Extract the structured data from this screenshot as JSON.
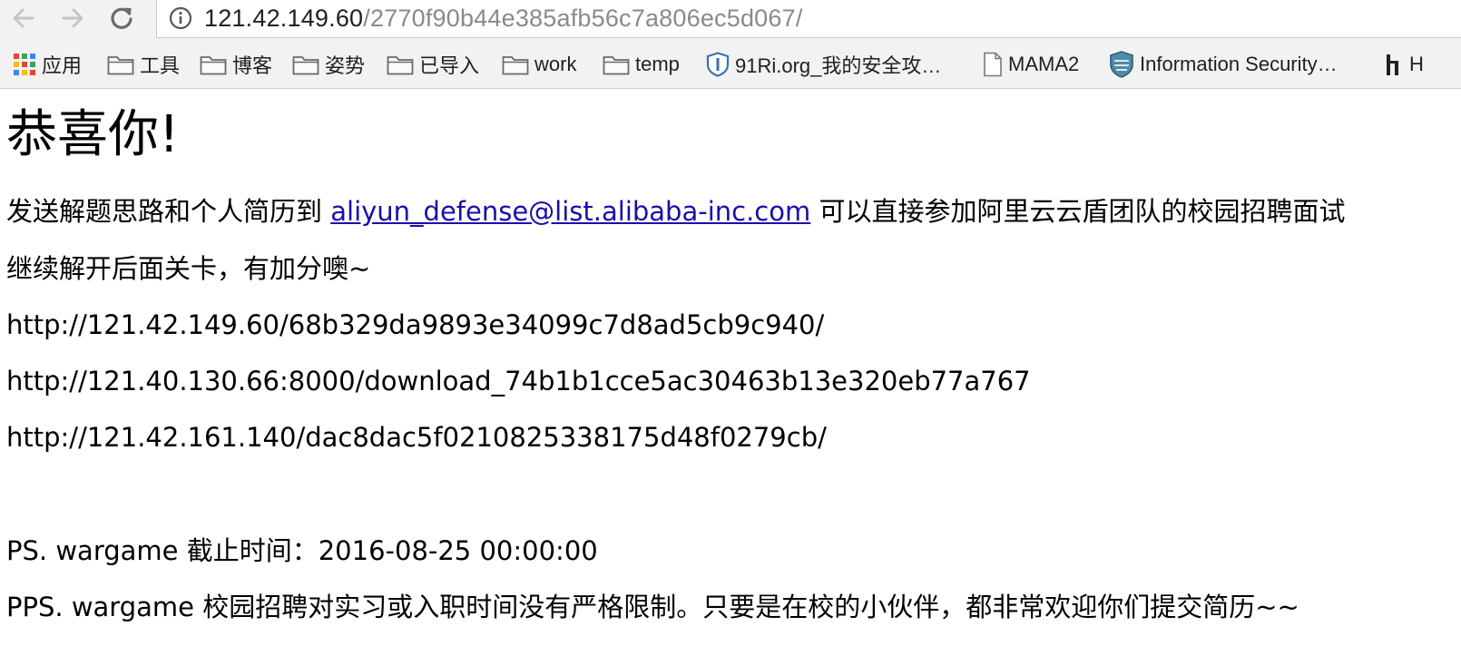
{
  "browser": {
    "url_host": "121.42.149.60",
    "url_path": "/2770f90b44e385afb56c7a806ec5d067/",
    "icons": {
      "back": "arrow-left-icon",
      "forward": "arrow-right-icon",
      "reload": "reload-icon",
      "site_info": "info-circle-icon"
    }
  },
  "bookmarks": [
    {
      "label": "应用",
      "icon": "apps-grid-icon"
    },
    {
      "label": "工具",
      "icon": "folder-icon"
    },
    {
      "label": "博客",
      "icon": "folder-icon"
    },
    {
      "label": "姿势",
      "icon": "folder-icon"
    },
    {
      "label": "已导入",
      "icon": "folder-icon"
    },
    {
      "label": "work",
      "icon": "folder-icon"
    },
    {
      "label": "temp",
      "icon": "folder-icon"
    },
    {
      "label": "91Ri.org_我的安全攻…",
      "icon": "shield-icon"
    },
    {
      "label": "MAMA2",
      "icon": "page-icon"
    },
    {
      "label": "Information Security…",
      "icon": "security-shield-icon"
    },
    {
      "label": "H",
      "icon": "bookmark-h-icon"
    }
  ],
  "page": {
    "heading": "恭喜你!",
    "resume_prefix": "发送解题思路和个人简历到 ",
    "email": "aliyun_defense@list.alibaba-inc.com",
    "resume_suffix": " 可以直接参加阿里云云盾团队的校园招聘面试",
    "continue_text": "继续解开后面关卡，有加分噢~",
    "links": [
      "http://121.42.149.60/68b329da9893e34099c7d8ad5cb9c940/",
      "http://121.40.130.66:8000/download_74b1b1cce5ac30463b13e320eb77a767",
      "http://121.42.161.140/dac8dac5f0210825338175d48f0279cb/"
    ],
    "ps": "PS.   wargame 截止时间：2016-08-25 00:00:00",
    "pps": "PPS. wargame 校园招聘对实习或入职时间没有严格限制。只要是在校的小伙伴，都非常欢迎你们提交简历~~"
  }
}
